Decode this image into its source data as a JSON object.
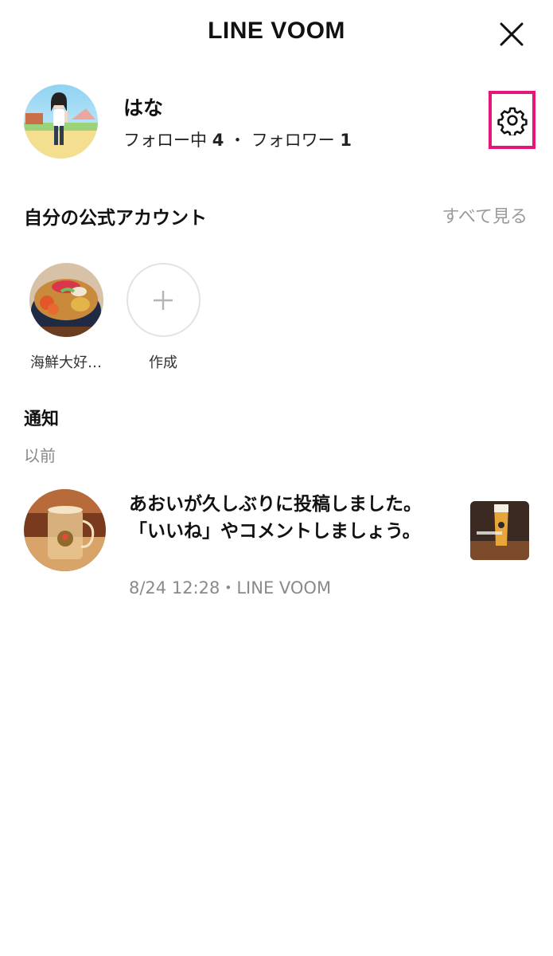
{
  "header": {
    "title": "LINE VOOM",
    "close_icon": "close-icon"
  },
  "profile": {
    "name": "はな",
    "following_label": "フォロー中",
    "following_count": "4",
    "separator": "・",
    "followers_label": "フォロワー",
    "followers_count": "1",
    "settings_icon": "gear-icon",
    "highlight_color": "#e5157a"
  },
  "official_accounts": {
    "title": "自分の公式アカウント",
    "see_all": "すべて見る",
    "items": [
      {
        "label": "海鮮大好…"
      },
      {
        "label": "作成",
        "icon": "plus-icon"
      }
    ]
  },
  "notifications": {
    "title": "通知",
    "group_label": "以前",
    "items": [
      {
        "text": "あおいが久しぶりに投稿しました。「いいね」やコメントしましょう。",
        "meta": "8/24 12:28・LINE VOOM"
      }
    ]
  }
}
